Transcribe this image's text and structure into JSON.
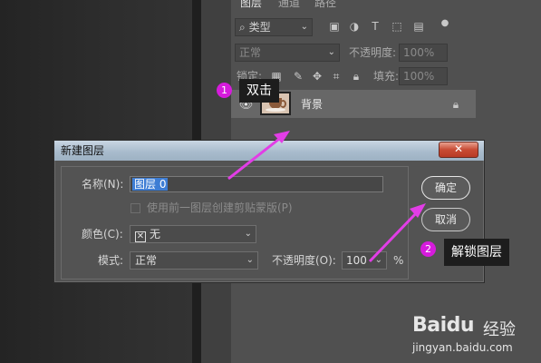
{
  "layers_panel": {
    "tabs": [
      "图层",
      "通道",
      "路径"
    ],
    "filter": {
      "label": "类型",
      "icons": [
        "image-filter-icon",
        "adjustment-filter-icon",
        "type-filter-icon",
        "shape-filter-icon",
        "smart-object-filter-icon",
        "filter-toggle-icon"
      ]
    },
    "blend_mode": "正常",
    "opacity_label": "不透明度:",
    "opacity_value": "100%",
    "lock_label": "锁定:",
    "fill_label": "填充:",
    "fill_value": "100%",
    "layer": {
      "name": "背景"
    }
  },
  "callouts": {
    "step1_number": "1",
    "step1_text": "双击",
    "step2_number": "2",
    "step2_text": "解锁图层"
  },
  "dialog": {
    "title": "新建图层",
    "close_glyph": "✕",
    "name_label": "名称(N):",
    "name_value": "图层 0",
    "clip_checkbox_label": "使用前一图层创建剪贴蒙版(P)",
    "color_label": "颜色(C):",
    "color_value": "无",
    "mode_label": "模式:",
    "mode_value": "正常",
    "opacity_label": "不透明度(O):",
    "opacity_value": "100",
    "percent": "%",
    "ok_label": "确定",
    "cancel_label": "取消"
  },
  "watermark": {
    "brand": "Baidu",
    "brand_cn": "经验",
    "url": "jingyan.baidu.com"
  },
  "colors": {
    "callout_accent": "#d61bdc",
    "arrow": "#e23de6",
    "selection": "#3e7dd4"
  }
}
